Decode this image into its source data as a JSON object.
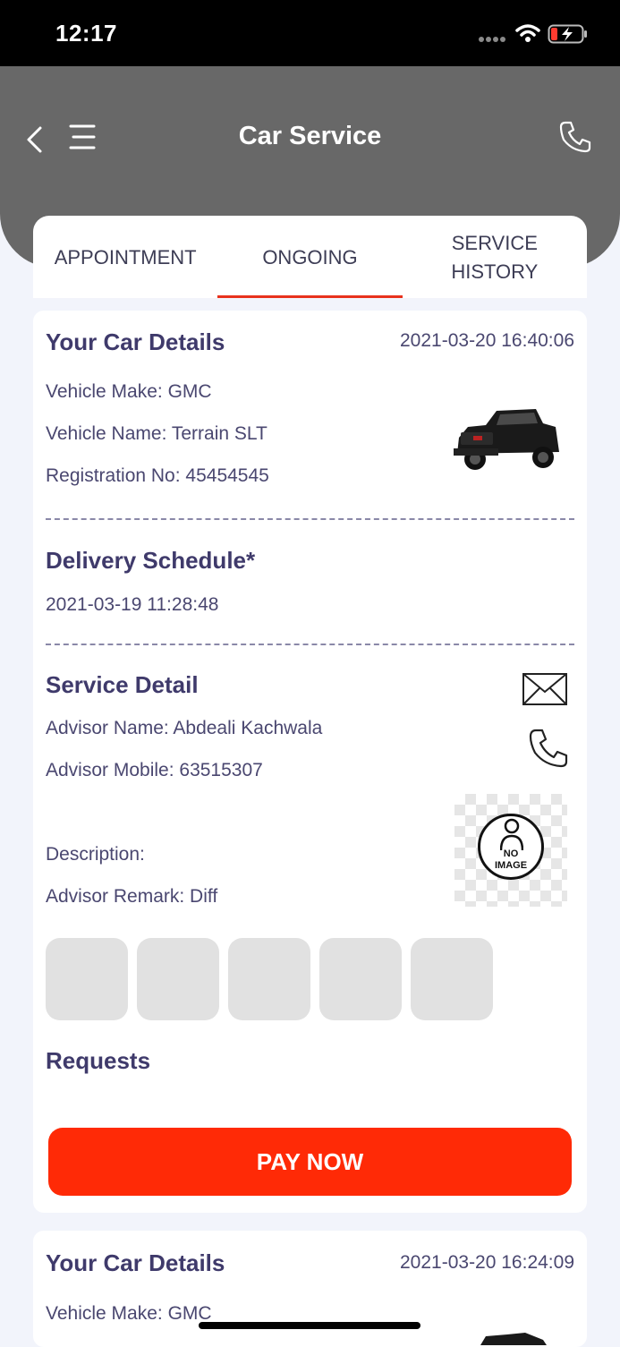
{
  "status": {
    "time": "12:17"
  },
  "header": {
    "title": "Car Service"
  },
  "tabs": [
    {
      "label": "APPOINTMENT"
    },
    {
      "label": "ONGOING"
    },
    {
      "label": "SERVICE\nHISTORY"
    }
  ],
  "active_tab": "ONGOING",
  "cards": [
    {
      "car_title": "Your Car Details",
      "datetime": "2021-03-20 16:40:06",
      "vehicle_make": "Vehicle Make: GMC",
      "vehicle_name": "Vehicle Name: Terrain SLT",
      "registration": "Registration No: 45454545",
      "delivery_title": "Delivery Schedule*",
      "delivery_datetime": "2021-03-19 11:28:48",
      "service_title": "Service Detail",
      "advisor_name": "Advisor Name: Abdeali Kachwala",
      "advisor_mobile": "Advisor Mobile: 63515307",
      "description": "Description:",
      "advisor_remark": "Advisor Remark: Diff",
      "no_image_label": "NO\nIMAGE",
      "requests_title": "Requests",
      "pay_label": "PAY NOW"
    },
    {
      "car_title": "Your Car Details",
      "datetime": "2021-03-20 16:24:09",
      "vehicle_make": "Vehicle Make: GMC"
    }
  ],
  "icons": {
    "back": "chevron-left-icon",
    "menu": "hamburger-menu-icon",
    "phone": "phone-icon",
    "mail": "envelope-icon",
    "vehicle": "pickup-truck-image"
  },
  "colors": {
    "accent": "#ff2a06",
    "header": "#686868",
    "title_text": "#3f3a6b",
    "tab_indicator": "#e8321d"
  }
}
